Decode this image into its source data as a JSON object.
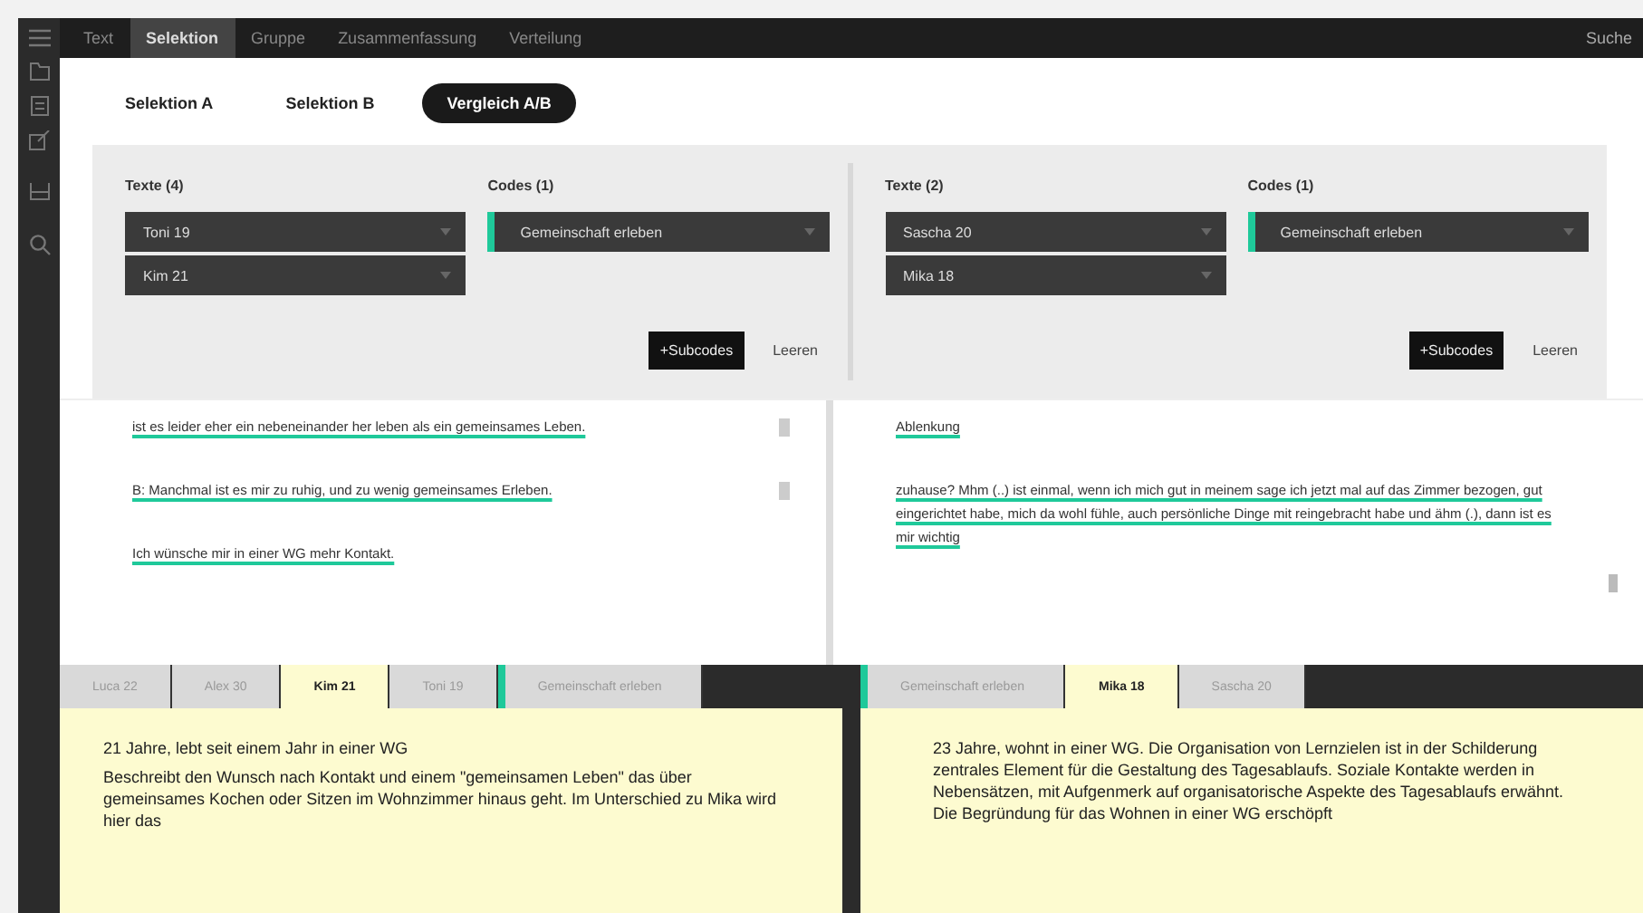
{
  "nav": {
    "tabs": [
      {
        "label": "Text",
        "selected": false
      },
      {
        "label": "Selektion",
        "selected": true
      },
      {
        "label": "Gruppe",
        "selected": false
      },
      {
        "label": "Zusammenfassung",
        "selected": false
      },
      {
        "label": "Verteilung",
        "selected": false
      }
    ],
    "search": "Suche"
  },
  "selection_tabs": [
    {
      "label": "Selektion A",
      "selected": false
    },
    {
      "label": "Selektion B",
      "selected": false
    },
    {
      "label": "Vergleich A/B",
      "selected": true
    }
  ],
  "comparison": [
    {
      "texts_label": "Texte (4)",
      "texts": [
        "Toni 19",
        "Kim 21"
      ],
      "codes_label": "Codes (1)",
      "codes": [
        {
          "label": "Gemeinschaft erleben",
          "color": "#1fc99a"
        }
      ],
      "subcodes_button": "+Subcodes",
      "clear_button": "Leeren"
    },
    {
      "texts_label": "Texte (2)",
      "texts": [
        "Sascha 20",
        "Mika 18"
      ],
      "codes_label": "Codes (1)",
      "codes": [
        {
          "label": "Gemeinschaft erleben",
          "color": "#1fc99a"
        }
      ],
      "subcodes_button": "+Subcodes",
      "clear_button": "Leeren"
    }
  ],
  "segments": [
    {
      "items": [
        {
          "text": "ist es leider eher ein nebeneinander her leben als ein gemeinsames Leben."
        },
        {
          "text": "B: Manchmal ist es mir zu ruhig, und zu wenig gemeinsames Erleben."
        },
        {
          "text": "Ich wünsche mir in einer WG mehr Kontakt."
        }
      ]
    },
    {
      "items": [
        {
          "text": "Ablenkung"
        },
        {
          "text": "zuhause? Mhm (..) ist einmal, wenn ich mich gut in meinem sage ich jetzt mal auf das Zimmer bezogen, gut eingerichtet habe, mich da wohl fühle, auch persönliche Dinge mit reingebracht habe und ähm (.), dann ist es mir wichtig"
        }
      ]
    }
  ],
  "detail_panes": [
    {
      "tabs": [
        {
          "label": "Luca 22",
          "kind": "text",
          "selected": false
        },
        {
          "label": "Alex 30",
          "kind": "text",
          "selected": false
        },
        {
          "label": "Kim 21",
          "kind": "text",
          "selected": true
        },
        {
          "label": "Toni 19",
          "kind": "text",
          "selected": false
        },
        {
          "label": "Gemeinschaft erleben",
          "kind": "code",
          "selected": false,
          "color": "#1fc99a"
        }
      ],
      "paragraphs": [
        "21 Jahre, lebt seit einem Jahr in einer WG",
        "Beschreibt den Wunsch nach Kontakt und einem \"gemeinsamen Leben\" das über gemeinsames Kochen oder Sitzen im Wohnzimmer hinaus geht. Im Unterschied zu Mika wird hier das"
      ]
    },
    {
      "tabs": [
        {
          "label": "Gemeinschaft erleben",
          "kind": "code",
          "selected": false,
          "color": "#1fc99a"
        },
        {
          "label": "Mika 18",
          "kind": "text",
          "selected": true
        },
        {
          "label": "Sascha 20",
          "kind": "text",
          "selected": false
        }
      ],
      "paragraphs": [
        "23 Jahre, wohnt in einer WG. Die Organisation von Lernzielen ist in der Schilderung zentrales Element für die Gestaltung des Tagesablaufs. Soziale Kontakte werden in Nebensätzen, mit Aufgenmerk auf organisatorische Aspekte des Tagesablaufs erwähnt. Die Begründung für das Wohnen in einer WG erschöpft"
      ]
    }
  ]
}
